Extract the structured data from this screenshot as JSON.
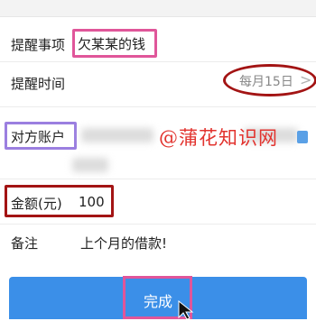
{
  "form": {
    "reminder_item": {
      "label": "提醒事项",
      "value": "欠某某的钱"
    },
    "reminder_time": {
      "label": "提醒时间",
      "value": "每月15日",
      "chevron": ">"
    },
    "counterparty_account": {
      "label": "对方账户"
    },
    "amount": {
      "label": "金额(元)",
      "value": "100"
    },
    "note": {
      "label": "备注",
      "value": "上个月的借款!"
    }
  },
  "watermark": "@蒲花知识网",
  "complete_button": {
    "label": "完成"
  },
  "colors": {
    "highlight_pink": "#e0569a",
    "highlight_purple": "#9b7fe0",
    "highlight_red": "#a31414",
    "button_blue": "#3b8fe8",
    "watermark_red": "#e2332e"
  }
}
